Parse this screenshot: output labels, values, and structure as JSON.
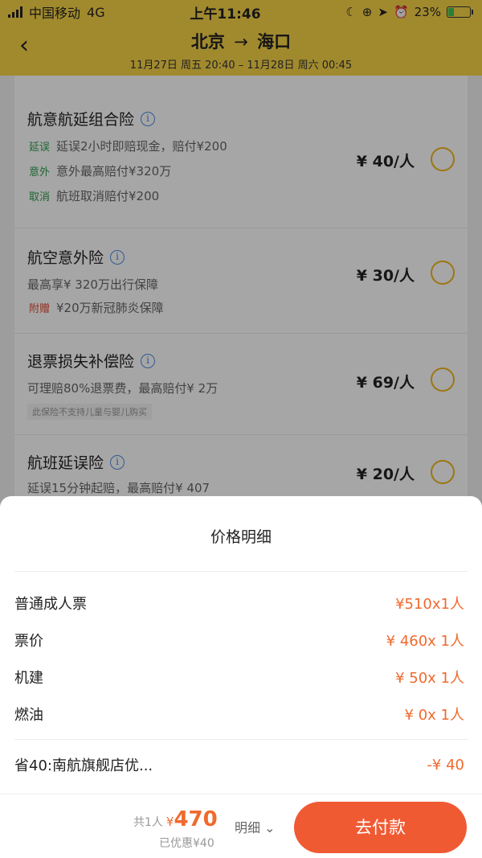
{
  "status_bar": {
    "carrier": "中国移动",
    "network": "4G",
    "time": "上午11:46",
    "battery_pct": "23%"
  },
  "header": {
    "back_icon": "chevron-left-icon",
    "from": "北京",
    "arrow": "→",
    "to": "海口",
    "times": "11月27日 周五 20:40 – 11月28日 周六 00:45"
  },
  "insurance": [
    {
      "title": "航意航延组合险",
      "lines": [
        {
          "tag": "延误",
          "text": "延误2小时即赔现金，赔付¥200"
        },
        {
          "tag": "意外",
          "text": "意外最高赔付¥320万"
        },
        {
          "tag": "取消",
          "text": "航班取消赔付¥200"
        }
      ],
      "price": "¥ 40/人"
    },
    {
      "title": "航空意外险",
      "lines": [
        {
          "tag": "",
          "text": "最高享¥ 320万出行保障"
        },
        {
          "tag": "附赠",
          "text": "¥20万新冠肺炎保障"
        }
      ],
      "price": "¥ 30/人"
    },
    {
      "title": "退票损失补偿险",
      "lines": [
        {
          "tag": "",
          "text": "可理赔80%退票费，最高赔付¥ 2万"
        }
      ],
      "note": "此保险不支持儿童与婴儿购买",
      "price": "¥ 69/人"
    },
    {
      "title": "航班延误险",
      "lines": [
        {
          "tag": "",
          "text": "延误15分钟起赔，最高赔付¥ 407"
        }
      ],
      "price": "¥ 20/人"
    }
  ],
  "price_detail": {
    "title": "价格明细",
    "rows": [
      {
        "label": "普通成人票",
        "value": "¥510x1人"
      },
      {
        "label": "票价",
        "value": "¥ 460x 1人"
      },
      {
        "label": "机建",
        "value": "¥ 50x 1人"
      },
      {
        "label": "燃油",
        "value": "¥ 0x 1人"
      }
    ],
    "discount": {
      "label": "省40:南航旗舰店优...",
      "value": "-¥ 40"
    }
  },
  "footer": {
    "count": "共1人",
    "yen": "¥",
    "total": "470",
    "saved": "已优惠¥40",
    "detail_label": "明细 ⌄",
    "pay_label": "去付款"
  },
  "colors": {
    "header_bg": "#f7d448",
    "accent": "#f06a2d",
    "pay_button": "#f05a33",
    "radio_border": "#f1b51c"
  }
}
